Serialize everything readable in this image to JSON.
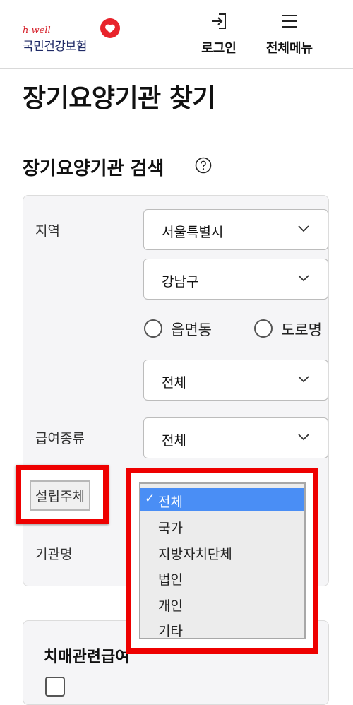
{
  "header": {
    "logo_small": "h·well",
    "logo_name": "국민건강보험",
    "login_label": "로그인",
    "menu_label": "전체메뉴"
  },
  "page": {
    "title": "장기요양기관 찾기",
    "section_title": "장기요양기관 검색"
  },
  "form": {
    "region_label": "지역",
    "region_city": "서울특별시",
    "region_district": "강남구",
    "radio_eupmyeondong": "읍면동",
    "radio_road": "도로명",
    "region_sub": "전체",
    "benefit_label": "급여종류",
    "benefit_value": "전체",
    "founder_label": "설립주체",
    "institution_label": "기관명"
  },
  "dropdown": {
    "options": [
      "전체",
      "국가",
      "지방자치단체",
      "법인",
      "개인",
      "기타"
    ],
    "selected_index": 0,
    "check_mark": "✓"
  },
  "section2": {
    "title": "치매관련급여"
  },
  "colors": {
    "brand_red": "#d6202a",
    "brand_navy": "#1f2a66",
    "highlight": "#ee0000",
    "selection": "#4a8ef5"
  }
}
